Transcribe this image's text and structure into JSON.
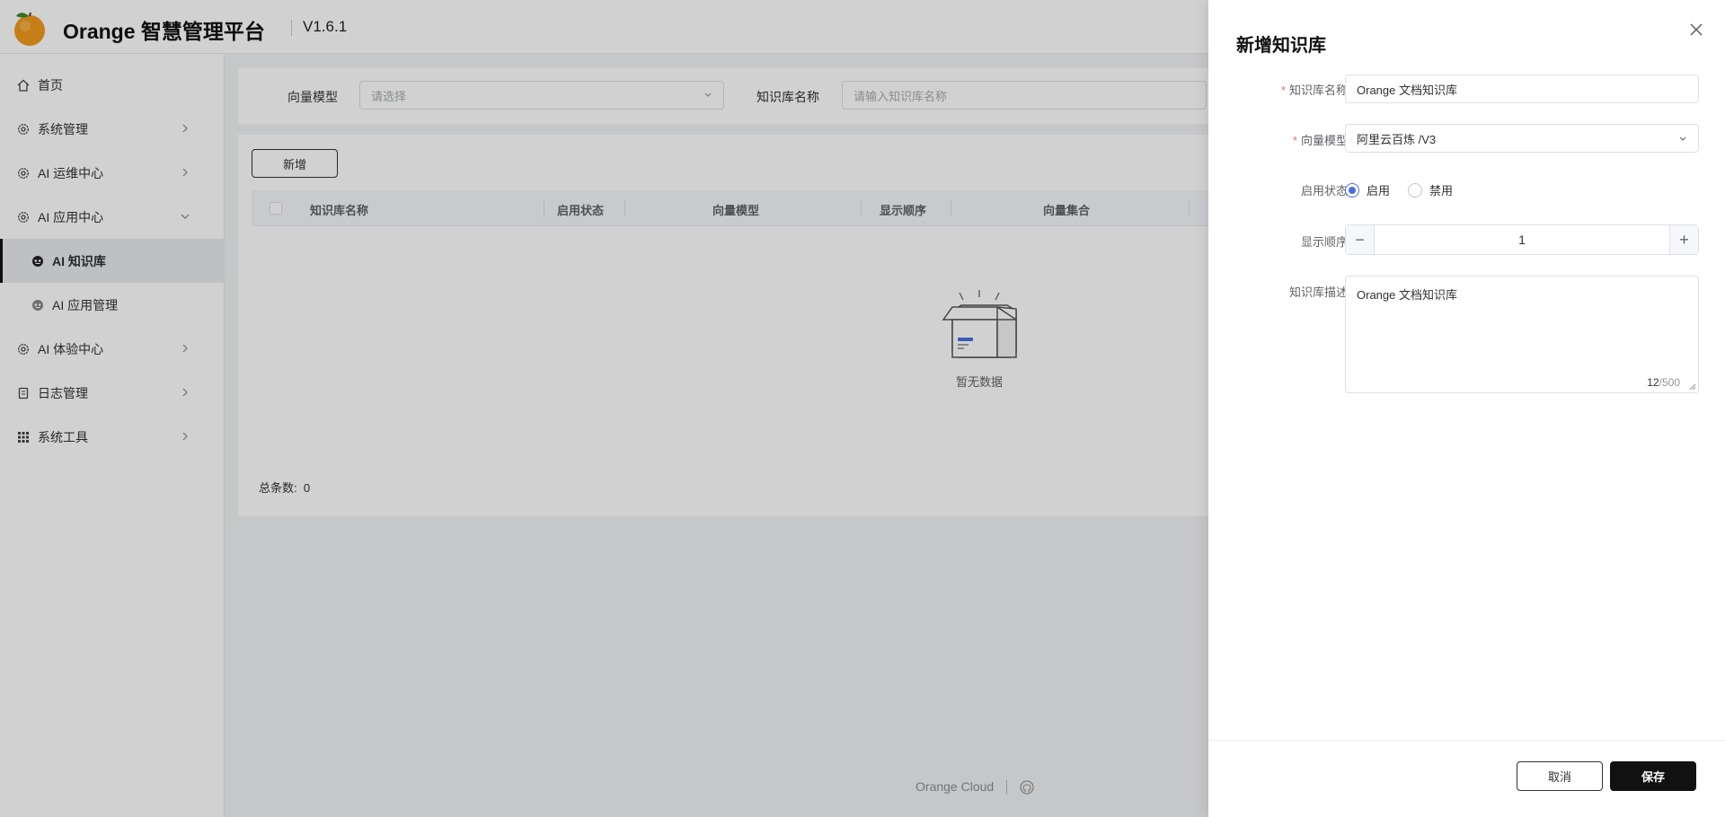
{
  "header": {
    "brand": "Orange 智慧管理平台",
    "version": "V1.6.1"
  },
  "sidebar": {
    "items": [
      {
        "label": "首页",
        "icon": "home-icon"
      },
      {
        "label": "系统管理",
        "icon": "gear-icon"
      },
      {
        "label": "AI 运维中心",
        "icon": "gear-icon"
      },
      {
        "label": "AI 应用中心",
        "icon": "gear-icon",
        "expanded": true
      },
      {
        "label": "AI 知识库",
        "icon": "robot-icon",
        "active": true
      },
      {
        "label": "AI 应用管理",
        "icon": "robot-icon"
      },
      {
        "label": "AI 体验中心",
        "icon": "gear-icon"
      },
      {
        "label": "日志管理",
        "icon": "document-icon"
      },
      {
        "label": "系统工具",
        "icon": "grid-icon"
      }
    ]
  },
  "search": {
    "model_label": "向量模型",
    "model_placeholder": "请选择",
    "name_label": "知识库名称",
    "name_placeholder": "请输入知识库名称"
  },
  "table": {
    "add_label": "新增",
    "columns": [
      "知识库名称",
      "启用状态",
      "向量模型",
      "显示顺序",
      "向量集合"
    ],
    "empty_text": "暂无数据",
    "total_label": "总条数:",
    "total_value": "0"
  },
  "footer": {
    "text": "Orange Cloud"
  },
  "drawer": {
    "title": "新增知识库",
    "name_label": "知识库名称",
    "name_value": "Orange 文档知识库",
    "model_label": "向量模型",
    "model_value": "阿里云百炼 /V3",
    "status_label": "启用状态",
    "status_on": "启用",
    "status_off": "禁用",
    "status_selected": "启用",
    "order_label": "显示顺序",
    "order_value": "1",
    "desc_label": "知识库描述",
    "desc_value": "Orange 文档知识库",
    "desc_count": "12",
    "desc_max": "/500",
    "cancel_label": "取消",
    "save_label": "保存"
  },
  "colors": {
    "accent": "#4a6ee0",
    "required": "#f56c6c",
    "primary_button": "#111111"
  }
}
